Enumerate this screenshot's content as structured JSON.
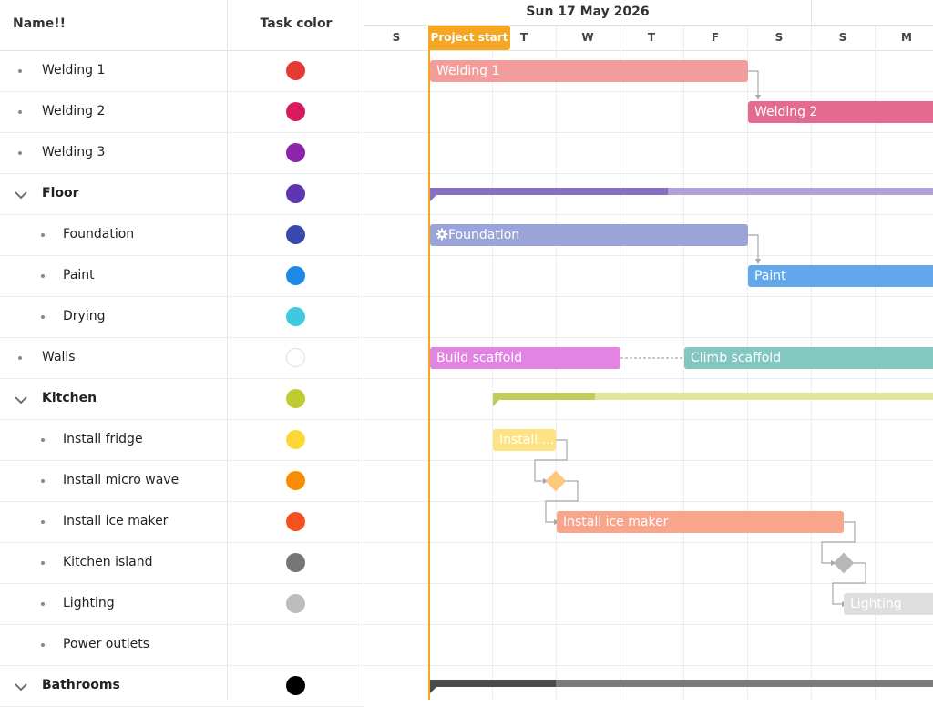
{
  "grid": {
    "header_name": "Name!!",
    "header_color": "Task color",
    "rows": [
      {
        "label": "Welding 1",
        "color": "#e53935"
      },
      {
        "label": "Welding 2",
        "color": "#d81b60"
      },
      {
        "label": "Welding 3",
        "color": "#8e24aa"
      },
      {
        "label": "Floor",
        "color": "#5e35b1"
      },
      {
        "label": "Foundation",
        "color": "#3949ab"
      },
      {
        "label": "Paint",
        "color": "#1e88e5"
      },
      {
        "label": "Drying",
        "color": "#3fc8df"
      },
      {
        "label": "Walls",
        "color": "#ffffff"
      },
      {
        "label": "Kitchen",
        "color": "#c0ca33"
      },
      {
        "label": "Install fridge",
        "color": "#fdd835"
      },
      {
        "label": "Install micro wave",
        "color": "#fb8c00"
      },
      {
        "label": "Install ice maker",
        "color": "#f4511e"
      },
      {
        "label": "Kitchen island",
        "color": "#757575"
      },
      {
        "label": "Lighting",
        "color": "#bdbdbd"
      },
      {
        "label": "Power outlets",
        "color": ""
      },
      {
        "label": "Bathrooms",
        "color": "#000000"
      }
    ]
  },
  "timeline": {
    "week_label": "Sun 17 May 2026",
    "days": [
      "S",
      "",
      "T",
      "W",
      "T",
      "F",
      "S",
      "S",
      "M"
    ],
    "project_start_label": "Project start",
    "bars": {
      "welding1": "Welding 1",
      "welding2": "Welding 2",
      "foundation": "Foundation",
      "paint": "Paint",
      "build_scaffold": "Build scaffold",
      "climb_scaffold": "Climb scaffold",
      "install_fridge": "Install ...",
      "install_ice_maker": "Install ice maker",
      "lighting": "Lighting"
    },
    "icons": {
      "foundation": "gear-icon",
      "parent_rows": "chevron-down-icon"
    }
  }
}
